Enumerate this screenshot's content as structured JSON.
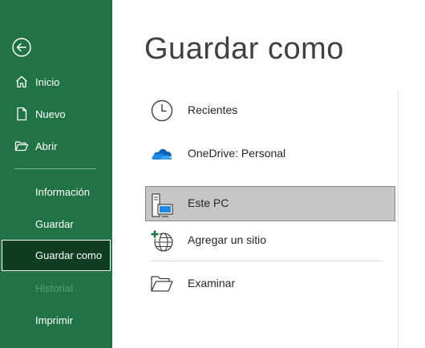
{
  "sidebar": {
    "items": [
      {
        "label": "Inicio"
      },
      {
        "label": "Nuevo"
      },
      {
        "label": "Abrir"
      },
      {
        "label": "Información"
      },
      {
        "label": "Guardar"
      },
      {
        "label": "Guardar como"
      },
      {
        "label": "Historial"
      },
      {
        "label": "Imprimir"
      }
    ]
  },
  "main": {
    "title": "Guardar como",
    "locations": [
      {
        "label": "Recientes",
        "icon": "clock-icon"
      },
      {
        "label": "OneDrive: Personal",
        "icon": "onedrive-cloud-icon"
      },
      {
        "label": "Este PC",
        "icon": "computer-icon",
        "selected": true
      },
      {
        "label": "Agregar un sitio",
        "icon": "add-globe-icon"
      },
      {
        "label": "Examinar",
        "icon": "folder-icon"
      }
    ]
  },
  "colors": {
    "sidebar_bg": "#217346",
    "selected_nav_bg": "#0e3d22",
    "selected_location_bg": "#c6c6c6",
    "onedrive_blue": "#0a64b5"
  }
}
